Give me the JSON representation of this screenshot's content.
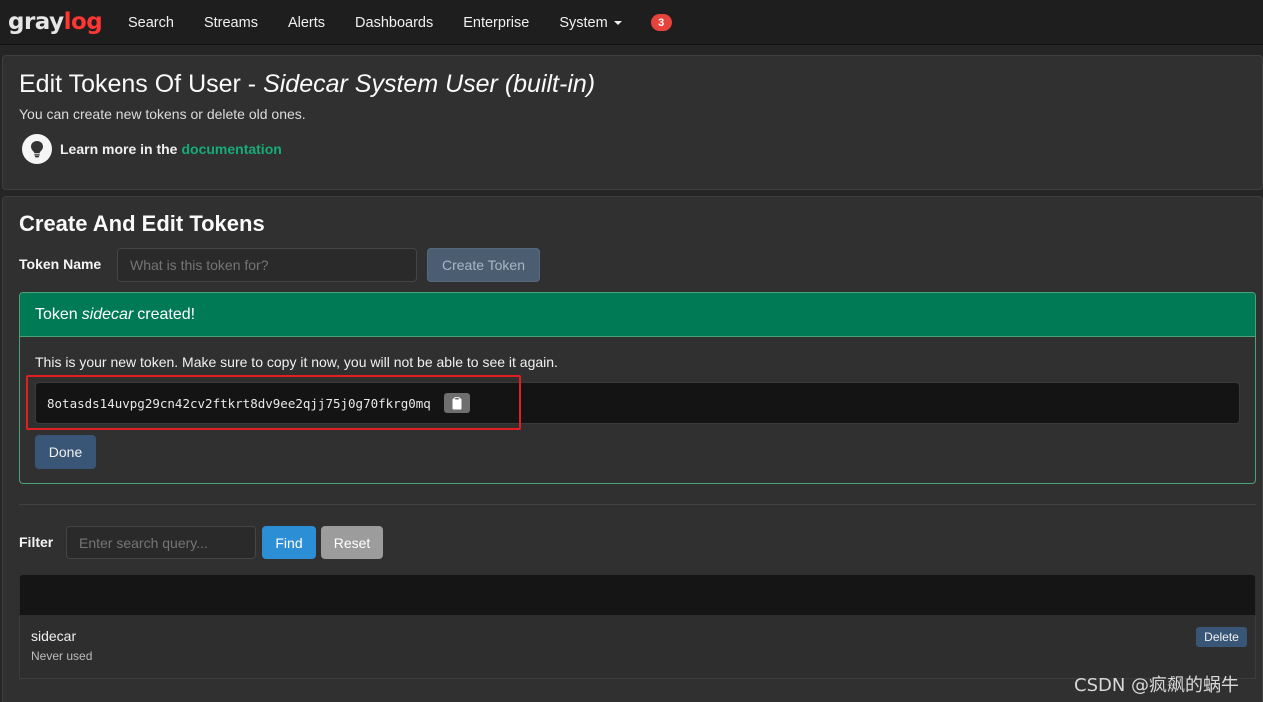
{
  "navbar": {
    "logo_part1": "gray",
    "logo_part2": "log",
    "items": [
      {
        "label": "Search"
      },
      {
        "label": "Streams"
      },
      {
        "label": "Alerts"
      },
      {
        "label": "Dashboards"
      },
      {
        "label": "Enterprise"
      },
      {
        "label": "System"
      }
    ],
    "notification_count": "3"
  },
  "header": {
    "title_prefix": "Edit Tokens Of User - ",
    "title_user": "Sidecar System User (built-in)",
    "description": "You can create new tokens or delete old ones.",
    "learn_more_text": "Learn more in the",
    "doc_link": "documentation"
  },
  "tokens": {
    "section_title": "Create And Edit Tokens",
    "token_name_label": "Token Name",
    "token_name_placeholder": "What is this token for?",
    "create_button": "Create Token",
    "success": {
      "prefix": "Token",
      "token_name": "sidecar",
      "suffix": "created!",
      "message": "This is your new token. Make sure to copy it now, you will not be able to see it again.",
      "token_value": "8otasds14uvpg29cn42cv2ftkrt8dv9ee2qjj75j0g70fkrg0mq",
      "done_button": "Done"
    },
    "filter": {
      "label": "Filter",
      "placeholder": "Enter search query...",
      "find_button": "Find",
      "reset_button": "Reset"
    },
    "list": [
      {
        "name": "sidecar",
        "status": "Never used",
        "delete_button": "Delete"
      }
    ]
  },
  "watermark": "CSDN @疯飙的蜗牛",
  "colors": {
    "brand_red": "#ff3633",
    "success_green": "#007a55",
    "link_green": "#16ac77",
    "primary_blue": "#2c8fd6",
    "highlight_red": "#e02020"
  }
}
